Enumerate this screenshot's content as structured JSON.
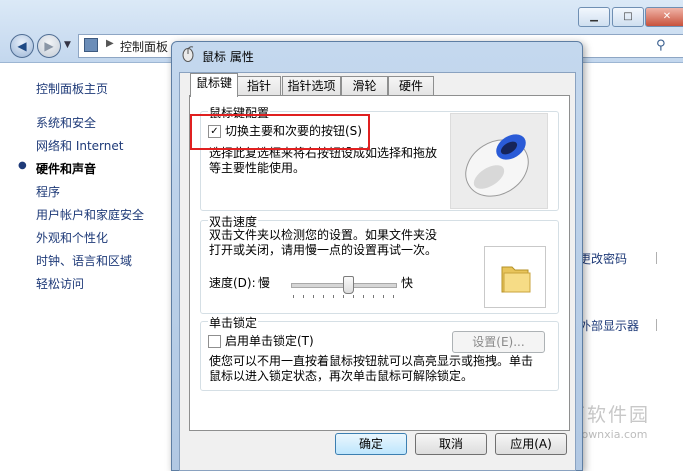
{
  "control_panel": {
    "address_text": "控制面板",
    "sidebar": {
      "home": "控制面板主页",
      "items": [
        "系统和安全",
        "网络和 Internet",
        "硬件和声音",
        "程序",
        "用户帐户和家庭安全",
        "外观和个性化",
        "时钟、语言和区域",
        "轻松访问"
      ],
      "current_index": 2
    },
    "bg_links": [
      "更改密码",
      "外部显示器"
    ]
  },
  "dialog": {
    "title": "鼠标 属性",
    "tabs": [
      "鼠标键",
      "指针",
      "指针选项",
      "滑轮",
      "硬件"
    ],
    "active_tab": 0,
    "button_config": {
      "legend": "鼠标键配置",
      "checkbox_label": "切换主要和次要的按钮(S)",
      "checked": true,
      "description_line1": "选择此复选框来将右按钮设成如选择和拖放",
      "description_line2": "等主要性能使用。"
    },
    "double_click": {
      "legend": "双击速度",
      "description_line1": "双击文件夹以检测您的设置。如果文件夹没",
      "description_line2": "打开或关闭，请用慢一点的设置再试一次。",
      "speed_label": "速度(D):",
      "slow_label": "慢",
      "fast_label": "快",
      "speed_value": 0.55
    },
    "click_lock": {
      "legend": "单击锁定",
      "checkbox_label": "启用单击锁定(T)",
      "checked": false,
      "settings_button": "设置(E)...",
      "description_line1": "使您可以不用一直按着鼠标按钮就可以高亮显示或拖拽。单击",
      "description_line2": "鼠标以进入锁定状态，再次单击鼠标可解除锁定。"
    },
    "buttons": {
      "ok": "确定",
      "cancel": "取消",
      "apply": "应用(A)"
    }
  },
  "watermark": {
    "title": "当下软件园",
    "url": "www.downxia.com"
  }
}
